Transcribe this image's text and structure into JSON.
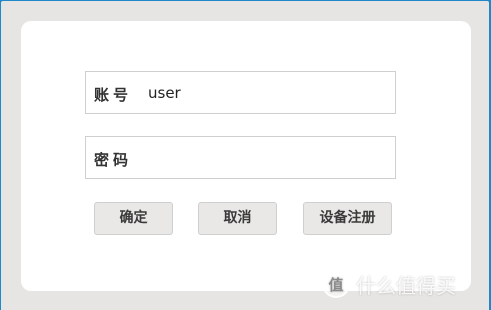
{
  "login": {
    "account_label": "账号",
    "account_value": "user",
    "password_label": "密码",
    "password_value": ""
  },
  "buttons": {
    "confirm": "确定",
    "cancel": "取消",
    "register": "设备注册"
  },
  "watermark": {
    "logo_text": "值",
    "text": "什么值得买"
  },
  "colors": {
    "outer_border": "#1e88c9",
    "background": "#e6e5e3",
    "card": "#ffffff",
    "button": "#e9e8e6"
  }
}
